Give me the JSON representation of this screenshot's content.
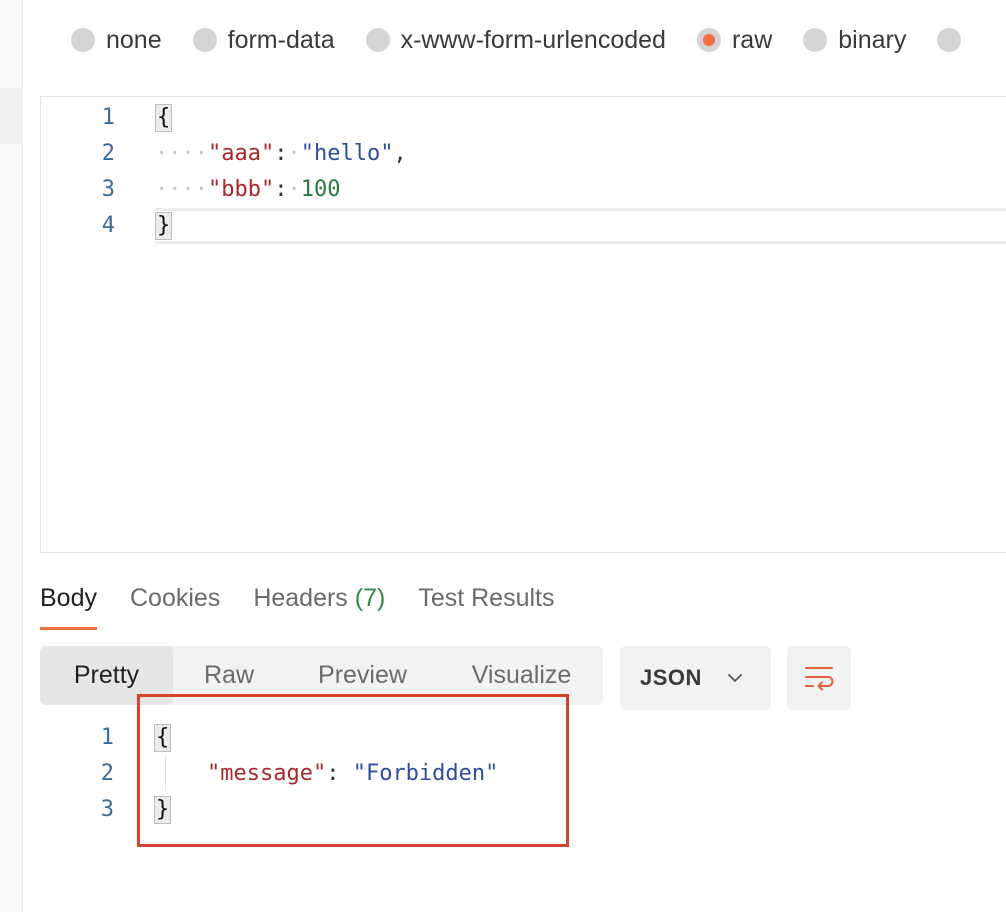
{
  "body_types": [
    {
      "label": "none",
      "checked": false
    },
    {
      "label": "form-data",
      "checked": false
    },
    {
      "label": "x-www-form-urlencoded",
      "checked": false
    },
    {
      "label": "raw",
      "checked": true
    },
    {
      "label": "binary",
      "checked": false
    }
  ],
  "request_editor": {
    "line_numbers": [
      "1",
      "2",
      "3",
      "4"
    ],
    "open_brace": "{",
    "close_brace": "}",
    "key1": "\"aaa\"",
    "value1": "\"hello\"",
    "key2": "\"bbb\"",
    "value2": "100"
  },
  "response_tabs": {
    "body": "Body",
    "cookies": "Cookies",
    "headers": "Headers",
    "headers_count": "(7)",
    "test_results": "Test Results"
  },
  "view_modes": [
    "Pretty",
    "Raw",
    "Preview",
    "Visualize"
  ],
  "format_select": {
    "selected": "JSON"
  },
  "response_body": {
    "line_numbers": [
      "1",
      "2",
      "3"
    ],
    "open_brace": "{",
    "close_brace": "}",
    "key": "\"message\"",
    "value": "\"Forbidden\""
  },
  "colors": {
    "accent": "#ef6f3c",
    "highlight_box": "#d8432f",
    "json_key": "#a8282b",
    "json_string": "#2f4f9a",
    "json_number": "#2c7a3a",
    "headers_count": "#2f8a44"
  }
}
